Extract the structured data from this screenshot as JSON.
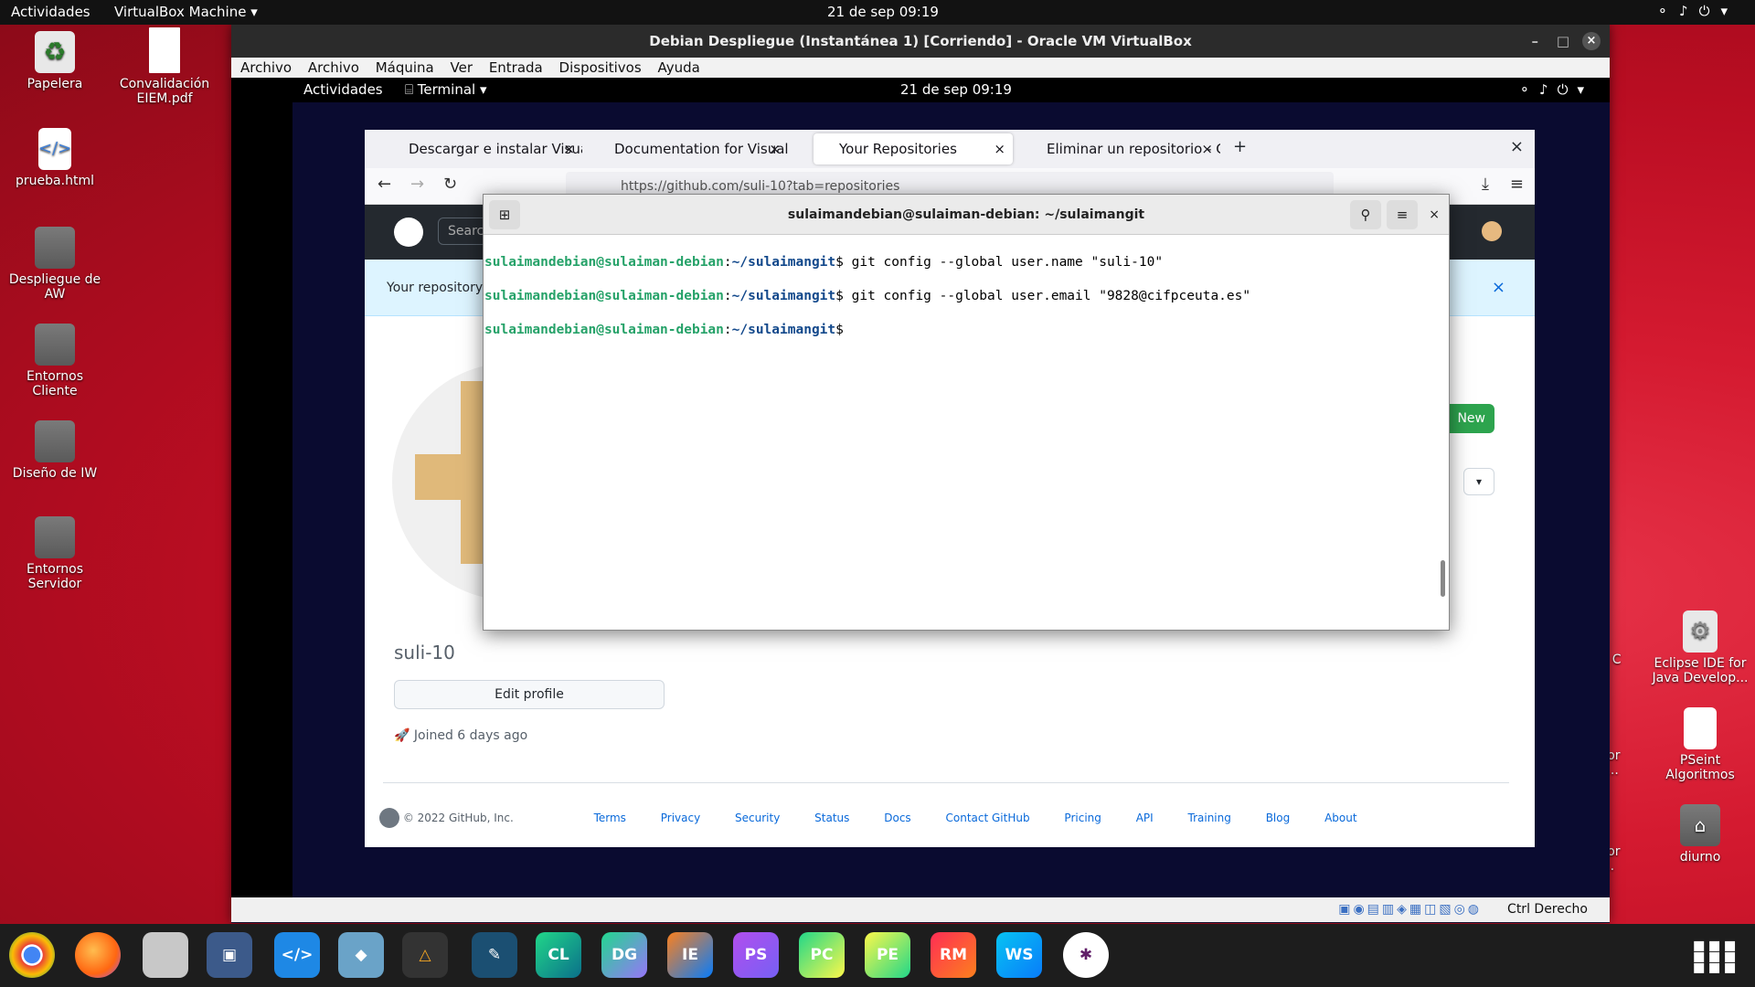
{
  "topbar": {
    "activities": "Actividades",
    "app": "VirtualBox Machine",
    "clock": "21 de sep  09:19"
  },
  "desktop": {
    "left": [
      {
        "label": "Papelera"
      },
      {
        "label": "Convalidación EIEM.pdf"
      },
      {
        "label": "prueba.html"
      },
      {
        "label": "Despliegue de AW"
      },
      {
        "label": "Entornos Cliente"
      },
      {
        "label": "Diseño de IW"
      },
      {
        "label": "Entornos Servidor"
      }
    ],
    "right": [
      {
        "label": "Eclipse IDE for Java Develop..."
      },
      {
        "label": "PSeint Algoritmos"
      },
      {
        "label": "diurno"
      }
    ],
    "partial": [
      "for C",
      "E for op...",
      "E for Ja..."
    ]
  },
  "vbox": {
    "title": "Debian Despliegue (Instantánea 1) [Corriendo] - Oracle VM VirtualBox",
    "menu": [
      "Archivo",
      "Archivo",
      "Máquina",
      "Ver",
      "Entrada",
      "Dispositivos",
      "Ayuda"
    ],
    "status": "Ctrl Derecho"
  },
  "guest": {
    "activities": "Actividades",
    "app": "Terminal",
    "clock": "21 de sep  09:19"
  },
  "firefox": {
    "tabs": [
      {
        "label": "Descargar e instalar Visua",
        "active": false
      },
      {
        "label": "Documentation for Visual",
        "active": false
      },
      {
        "label": "Your Repositories",
        "active": true
      },
      {
        "label": "Eliminar un repositorio - G",
        "active": false
      }
    ],
    "url": "https://github.com/suli-10?tab=repositories"
  },
  "github": {
    "search": "Searc",
    "flash": "Your repository \"s",
    "username": "suli-10",
    "edit_profile": "Edit profile",
    "joined": "Joined 6 days ago",
    "new_button": "New",
    "footer": {
      "copyright": "© 2022 GitHub, Inc.",
      "links": [
        "Terms",
        "Privacy",
        "Security",
        "Status",
        "Docs",
        "Contact GitHub",
        "Pricing",
        "API",
        "Training",
        "Blog",
        "About"
      ]
    }
  },
  "terminal": {
    "title": "sulaimandebian@sulaiman-debian: ~/sulaimangit",
    "lines": [
      {
        "user": "sulaimandebian@sulaiman-debian",
        "path": "~/sulaimangit",
        "cmd": " git config --global user.name \"suli-10\""
      },
      {
        "user": "sulaimandebian@sulaiman-debian",
        "path": "~/sulaimangit",
        "cmd": " git config --global user.email \"9828@cifpceuta.es\""
      },
      {
        "user": "sulaimandebian@sulaiman-debian",
        "path": "~/sulaimangit",
        "cmd": " "
      }
    ]
  },
  "dock": [
    "CL",
    "DG",
    "IE",
    "PS",
    "PC",
    "PE",
    "RM",
    "WS"
  ]
}
